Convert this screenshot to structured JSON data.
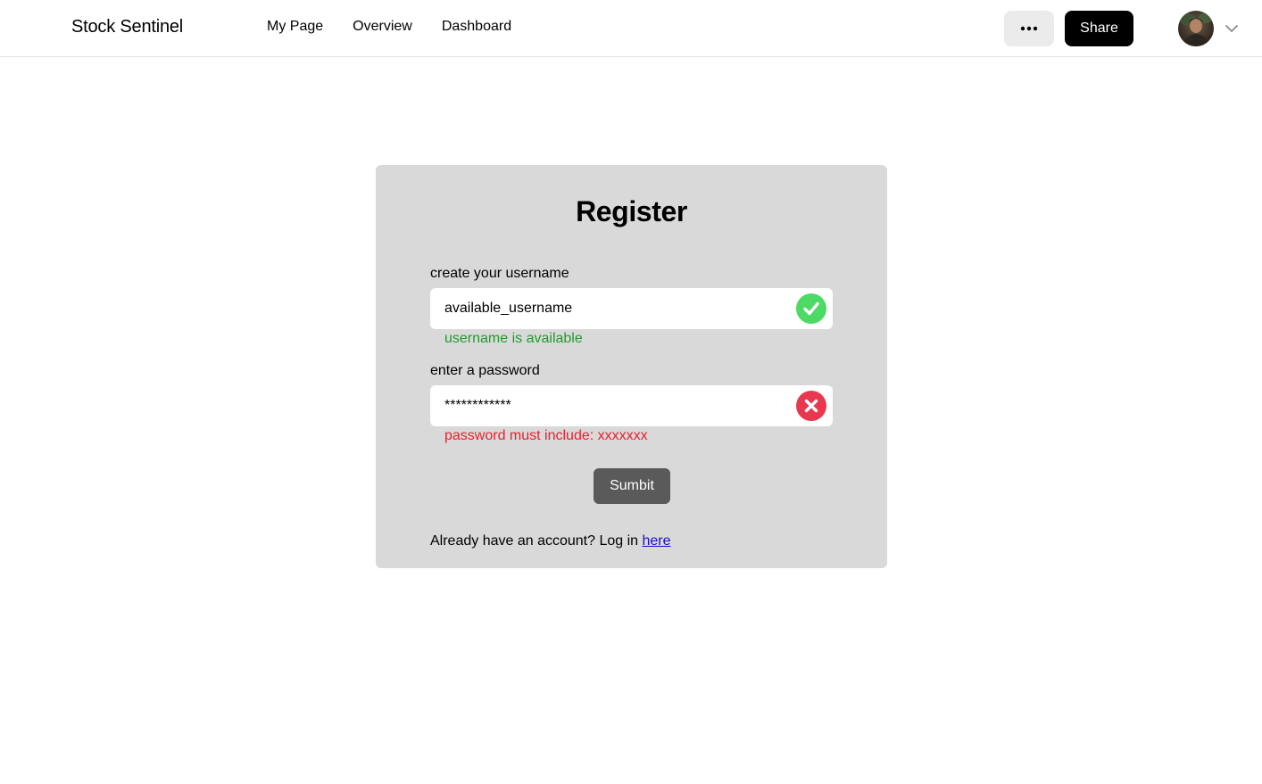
{
  "header": {
    "brand": "Stock Sentinel",
    "nav": [
      {
        "label": "My Page"
      },
      {
        "label": "Overview"
      },
      {
        "label": "Dashboard"
      }
    ],
    "more_icon": "more-horizontal-icon",
    "share_label": "Share",
    "avatar_icon": "avatar",
    "chevron_icon": "chevron-down-icon"
  },
  "form": {
    "title": "Register",
    "username": {
      "label": "create your username",
      "value": "available_username",
      "status_icon": "check-circle-icon",
      "status_color": "#4cd964",
      "helper": "username is available"
    },
    "password": {
      "label": "enter a password",
      "value": "************",
      "status_icon": "x-circle-icon",
      "status_color": "#e8384f",
      "helper": "password must include: xxxxxxx"
    },
    "submit_label": "Sumbit",
    "login_prompt": "Already have an account? Log in ",
    "login_link": "here"
  },
  "colors": {
    "card_background": "#d9d9d9",
    "success_text": "#1f9c2b",
    "error_text": "#e8202f",
    "link": "#1a0dcc"
  }
}
